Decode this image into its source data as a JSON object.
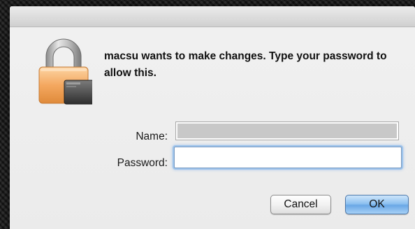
{
  "dialog": {
    "message": "macsu wants to make changes. Type your password to allow this."
  },
  "fields": {
    "name_label": "Name:",
    "name_value": "",
    "password_label": "Password:",
    "password_value": ""
  },
  "buttons": {
    "cancel_label": "Cancel",
    "ok_label": "OK"
  },
  "icons": {
    "lock": "padlock-icon"
  },
  "colors": {
    "default_button": "#7fb6ec",
    "focus_ring": "#9ec4ec",
    "lock_body": "#f4a860"
  }
}
